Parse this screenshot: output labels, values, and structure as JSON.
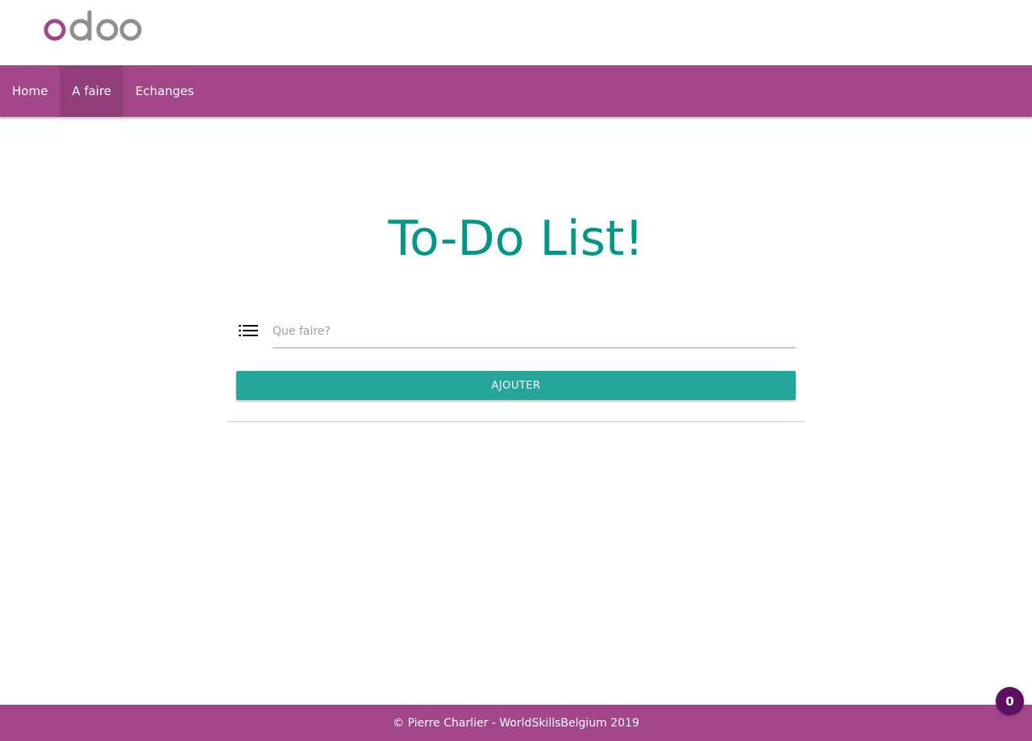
{
  "colors": {
    "primary": "#a24689",
    "teal": "#009688",
    "button_teal": "#26a69a",
    "badge": "#5b1060",
    "logo_gray": "#8f8f8f"
  },
  "header": {
    "logo_text": "odoo",
    "logo_icon": "odoo-logo"
  },
  "nav": {
    "items": [
      {
        "label": "Home",
        "active": false
      },
      {
        "label": "A faire",
        "active": true
      },
      {
        "label": "Echanges",
        "active": false
      }
    ]
  },
  "main": {
    "title": "To-Do List!",
    "input_icon": "list-icon",
    "input_placeholder": "Que faire?",
    "input_value": "",
    "add_button_label": "AJOUTER"
  },
  "footer": {
    "text": "© Pierre Charlier - WorldSkillsBelgium 2019"
  },
  "badge": {
    "count": "0"
  }
}
